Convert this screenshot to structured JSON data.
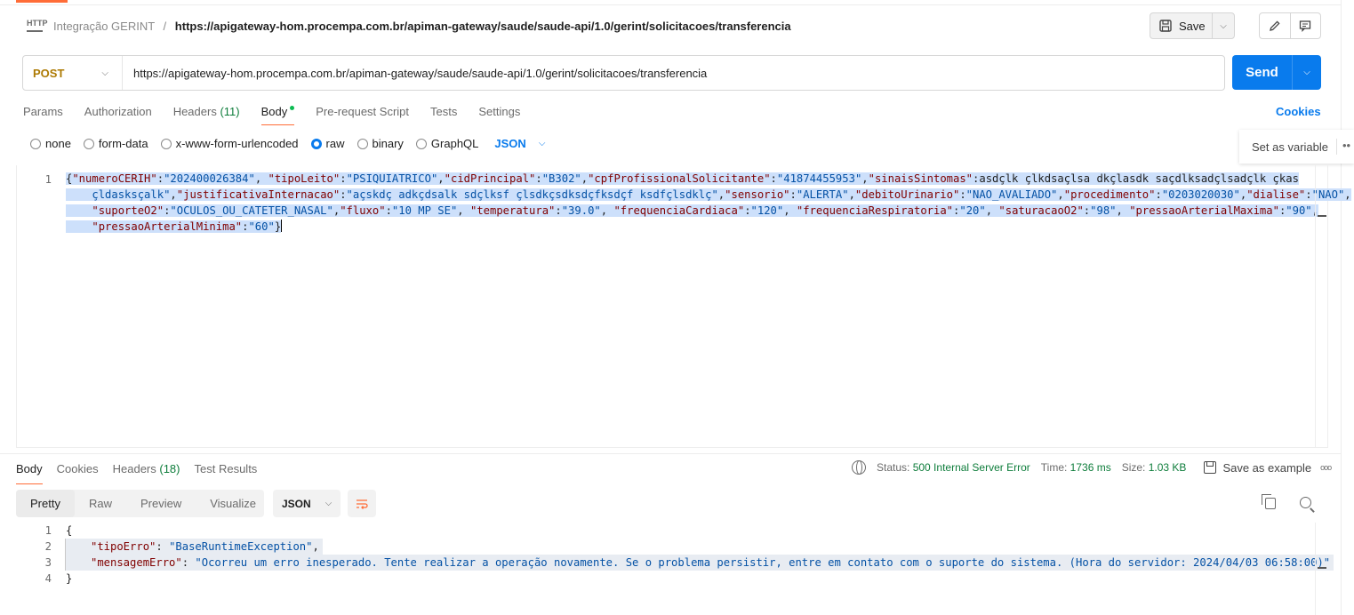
{
  "header": {
    "icon_label": "HTTP",
    "collection": "Integração GERINT",
    "separator": "/",
    "request_name": "https://apigateway-hom.procempa.com.br/apiman-gateway/saude/saude-api/1.0/gerint/solicitacoes/transferencia",
    "save_label": "Save"
  },
  "request": {
    "method": "POST",
    "url": "https://apigateway-hom.procempa.com.br/apiman-gateway/saude/saude-api/1.0/gerint/solicitacoes/transferencia",
    "send_label": "Send",
    "tabs": [
      {
        "label": "Params"
      },
      {
        "label": "Authorization"
      },
      {
        "label": "Headers",
        "count": "(11)"
      },
      {
        "label": "Body"
      },
      {
        "label": "Pre-request Script"
      },
      {
        "label": "Tests"
      },
      {
        "label": "Settings"
      }
    ],
    "cookies_label": "Cookies",
    "body_types": [
      "none",
      "form-data",
      "x-www-form-urlencoded",
      "raw",
      "binary",
      "GraphQL"
    ],
    "selected_body_type": "raw",
    "format": "JSON",
    "set_variable_label": "Set as variable",
    "body_line_number": "1",
    "body_lines": [
      "{\"numeroCERIH\":\"202400026384\", \"tipoLeito\":\"PSIQUIATRICO\",\"cidPrincipal\":\"B302\",\"cpfProfissionalSolicitante\":\"41874455953\",\"sinaisSintomas\":\"asdçlk çlkdsaçlsa dkçlasdk saçdlksadçlsadçlk çkas",
      "    çldasksçalk\",\"justificativaInternacao\":\"açskdç adkçdsalk sdçlksf çlsdkçsdksdçfksdçf ksdfçlsdklç\",\"sensorio\":\"ALERTA\",\"debitoUrinario\":\"NAO_AVALIADO\",\"procedimento\":\"0203020030\",\"dialise\":\"NAO\",",
      "    \"suporteO2\":\"OCULOS_OU_CATETER_NASAL\",\"fluxo\":\"10 MP SE\", \"temperatura\":\"39.0\", \"frequenciaCardiaca\":\"120\", \"frequenciaRespiratoria\":\"20\", \"saturacaoO2\":\"98\", \"pressaoArterialMaxima\":\"90\",",
      "    \"pressaoArterialMinima\":\"60\"}"
    ]
  },
  "response": {
    "tabs": [
      {
        "label": "Body"
      },
      {
        "label": "Cookies"
      },
      {
        "label": "Headers",
        "count": "(18)"
      },
      {
        "label": "Test Results"
      }
    ],
    "status_label": "Status:",
    "status_value": "500 Internal Server Error",
    "time_label": "Time:",
    "time_value": "1736 ms",
    "size_label": "Size:",
    "size_value": "1.03 KB",
    "save_example_label": "Save as example",
    "more_label": "ooo",
    "views": [
      "Pretty",
      "Raw",
      "Preview",
      "Visualize"
    ],
    "active_view": "Pretty",
    "format": "JSON",
    "lines": [
      {
        "num": "1",
        "text": "{"
      },
      {
        "num": "2",
        "key": "\"tipoErro\"",
        "value": "\"BaseRuntimeException\"",
        "trail": ","
      },
      {
        "num": "3",
        "key": "\"mensagemErro\"",
        "value": "\"Ocorreu um erro inesperado. Tente realizar a operação novamente. Se o problema persistir, entre em contato com o suporte do sistema. (Hora do servidor: 2024/04/03 06:58:00)\"",
        "trail": ""
      },
      {
        "num": "4",
        "text": "}"
      }
    ]
  },
  "colors": {
    "accent": "#ff6c37",
    "send_blue": "#097bed",
    "method_post": "#ad7a03",
    "status_ok_green": "#0e7d3b",
    "json_key": "#800000",
    "json_string": "#0451a5",
    "selection": "#cde0fb"
  }
}
